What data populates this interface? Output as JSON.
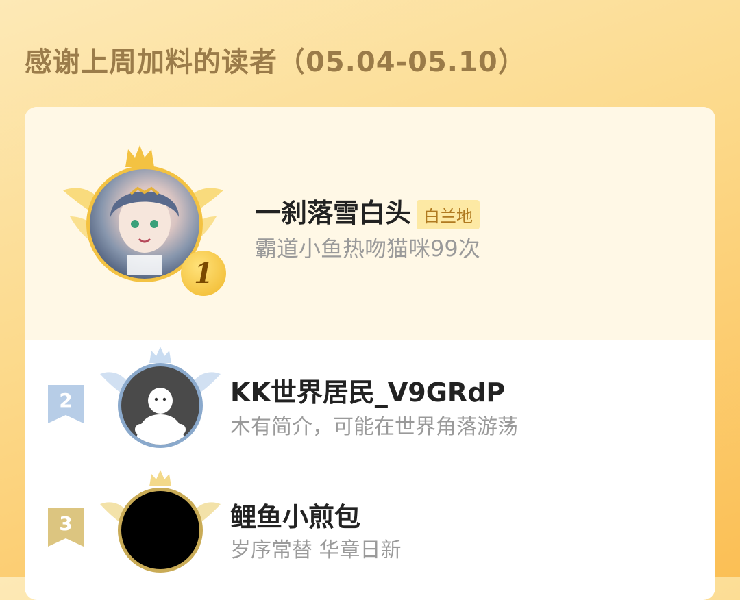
{
  "header": {
    "title": "感谢上周加料的读者（05.04-05.10）"
  },
  "colors": {
    "gold": "#f3c242",
    "silver": "#a9c6e6",
    "bronze": "#e3c77a",
    "name": "#222222",
    "desc": "#9a9a9a"
  },
  "readers": [
    {
      "rank": "1",
      "name": "一刹落雪白头",
      "badge": "白兰地",
      "desc": "霸道小鱼热吻猫咪99次",
      "icon": "crown-icon"
    },
    {
      "rank": "2",
      "name": "KK世界居民_V9GRdP",
      "desc": "木有简介，可能在世界角落游荡",
      "icon": "crown-icon"
    },
    {
      "rank": "3",
      "name": "鲤鱼小煎包",
      "desc": "岁序常替 华章日新",
      "icon": "crown-icon"
    }
  ]
}
